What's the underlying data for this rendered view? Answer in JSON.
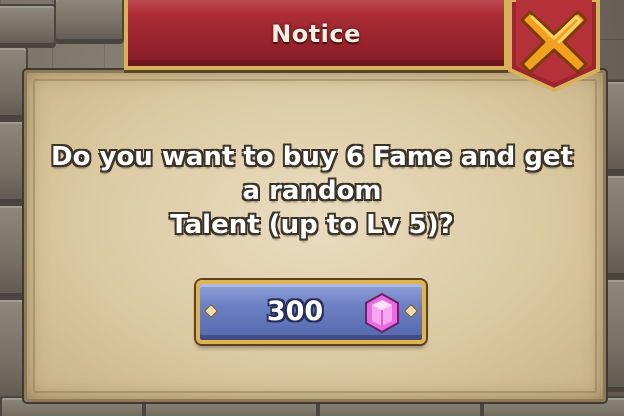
{
  "dialog": {
    "title": "Notice",
    "message_lines": [
      "Do you want to buy 6 Fame and get",
      "a random",
      "Talent (up to Lv 5)?"
    ],
    "buy_button": {
      "price": "300",
      "currency_icon": "gem-icon"
    },
    "close_icon": "close-icon"
  },
  "colors": {
    "banner": "#9c2530",
    "parchment": "#dccaa3",
    "button": "#6c7fc2",
    "gold_trim": "#e0b352",
    "close_x": "#f3a21f",
    "gem": "#e96be0"
  }
}
